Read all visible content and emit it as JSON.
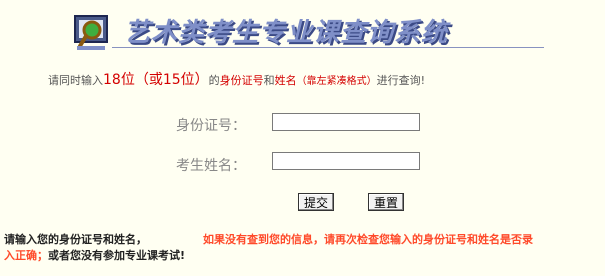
{
  "header": {
    "title": "艺术类考生专业课查询系统",
    "logo_icon": "magnifier-monitor-icon"
  },
  "instruction": {
    "prefix": "请同时输入",
    "digits": "18位（或15位）",
    "of": "的",
    "id_number": "身份证号",
    "and": "和",
    "name": "姓名",
    "format_note": "（靠左紧凑格式）",
    "suffix": "进行查询!"
  },
  "form": {
    "id_label": "身份证号：",
    "id_value": "",
    "name_label": "考生姓名：",
    "name_value": "",
    "submit_label": "提交",
    "reset_label": "重置"
  },
  "notes": {
    "left": "请输入您的身份证号和姓名，",
    "right": "如果没有查到您的信息，请再次检查您输入的身份证号和姓名是否录",
    "line2_red": "入正确；",
    "line2_dark": "或者您没有参加专业课考试!"
  },
  "colors": {
    "background": "#fffff2",
    "title": "#7f8fc8",
    "accent_red": "#d40000",
    "note_red": "#ff4a2a"
  }
}
